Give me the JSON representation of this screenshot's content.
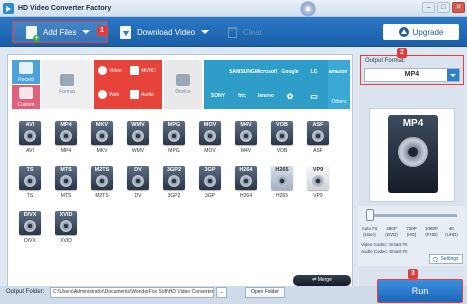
{
  "window": {
    "title": "HD Video Converter Factory",
    "controls": [
      "–",
      "□",
      "✕"
    ]
  },
  "toolbar": {
    "add_files_label": "Add Files",
    "download_label": "Download Video",
    "clear_label": "Clear",
    "upgrade_label": "Upgrade"
  },
  "badges": {
    "b1": "1",
    "b2": "2",
    "b3": "3"
  },
  "categories": {
    "recent": "Recent",
    "custom": "Custom",
    "format": "Format",
    "video": "Video",
    "hd_4k": "4K/HD",
    "web": "Web",
    "audio": "Audio",
    "device": "Device",
    "others": "Others"
  },
  "brands": [
    "",
    "SAMSUNG",
    "Microsoft",
    "Google",
    "LG",
    "amazon",
    "SONY",
    "htc",
    "lenovo",
    "",
    "",
    ""
  ],
  "formats_row1": [
    "AVI",
    "MP4",
    "MKV",
    "WMV",
    "MPG",
    "MOV",
    "M4V",
    "VOB",
    "ASF"
  ],
  "formats_row2": [
    "TS",
    "MTS",
    "M2TS",
    "DV",
    "3GP2",
    "3GP",
    "H264",
    "H265",
    "VP9"
  ],
  "formats_row3": [
    "DIVX",
    "XVID"
  ],
  "output": {
    "label": "Output Format:",
    "value": "MP4",
    "preview_text": "MP4"
  },
  "resolutions": [
    {
      "l1": "Auto Fit",
      "l2": "(User)"
    },
    {
      "l1": "480P",
      "l2": "(DVD)"
    },
    {
      "l1": "720P",
      "l2": "(HD)"
    },
    {
      "l1": "1080P",
      "l2": "(FHD)"
    },
    {
      "l1": "4K",
      "l2": "(UHD)"
    }
  ],
  "codecs": {
    "video": "Video Codec: Smart Fit",
    "audio": "Audio Codec: Smart Fit"
  },
  "settings_label": "Settings",
  "bottom": {
    "folder_label": "Output Folder:",
    "folder_path": "C:\\Users\\Administrator\\Documents\\WonderFox Soft\\HD Video Converter Fac",
    "browse_label": "...",
    "open_label": "Open Folder",
    "merge_label": "⇄ Merge",
    "run_label": "Run"
  },
  "colors": {
    "accent": "#1e66b8",
    "highlight": "#e84040",
    "web_block": "#e7433a",
    "brand_block": "#2e9ec8"
  }
}
